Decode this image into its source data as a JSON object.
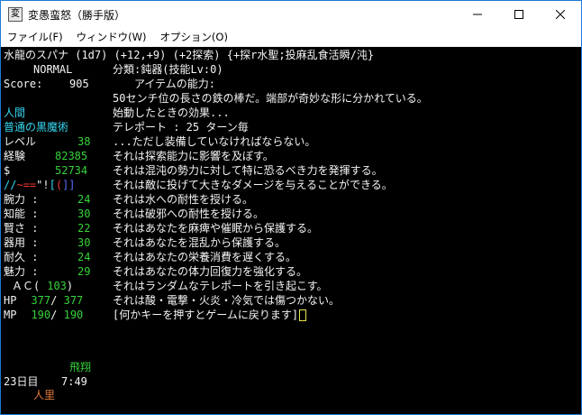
{
  "window": {
    "title": "変愚蛮怒（勝手版）",
    "icon_label": "変",
    "controls": [
      "minimize-icon",
      "maximize-icon",
      "close-icon"
    ]
  },
  "menubar": {
    "items": [
      "ファイル(F)",
      "ウィンドウ(W)",
      "オプション(O)"
    ]
  },
  "item_header": "水龍のスパナ (1d7) (+12,+9) (+2探索) {+探r水聖;投麻乱食活瞬/沌}",
  "status": {
    "mode": "NORMAL",
    "score_label": "Score:",
    "score": "905",
    "race": "人間",
    "class": "普通の黒魔術",
    "level_label": "レベル",
    "level": "38",
    "exp_label": "経験",
    "exp": "82385",
    "gold_label": "$",
    "gold": "52734",
    "equip_slash": "//",
    "equip_tilde": "~==",
    "equip_quote": "\"!",
    "equip_bracket": "[",
    "equip_paren": "(",
    "equip_close": "]]",
    "stats": [
      {
        "label": "腕力 :",
        "value": "24"
      },
      {
        "label": "知能 :",
        "value": "30"
      },
      {
        "label": "賢さ :",
        "value": "22"
      },
      {
        "label": "器用 :",
        "value": "30"
      },
      {
        "label": "耐久 :",
        "value": "24"
      },
      {
        "label": "魅力 :",
        "value": "29"
      }
    ],
    "ac_label": "ＡＣ(",
    "ac_value": "103",
    "ac_close": ")",
    "hp_label": "HP",
    "hp_cur": "377",
    "hp_max": "377",
    "mp_label": "MP",
    "mp_cur": "190",
    "mp_max": "190",
    "state": "飛翔",
    "day": "23日目",
    "time": "7:49",
    "location": "人里"
  },
  "description_lines": [
    "分類:鈍器(技能Lv:0)",
    "　　アイテムの能力:",
    "50センチ位の長さの鉄の棒だ。端部が奇妙な形に分かれている。",
    "始動したときの効果...",
    "テレポート : 25 ターン毎",
    "...ただし装備していなければならない。",
    "それは探索能力に影響を及ぼす。",
    "それは混沌の勢力に対して特に恐るべき力を発揮する。",
    "それは敵に投げて大きなダメージを与えることができる。",
    "それは水への耐性を授ける。",
    "それは破邪への耐性を授ける。",
    "それはあなたを麻痺や催眠から保護する。",
    "それはあなたを混乱から保護する。",
    "それはあなたの栄養消費を遅くする。",
    "それはあなたの体力回復力を強化する。",
    "それはランダムなテレポートを引き起こす。",
    "それは酸・電撃・火炎・冷気では傷つかない。",
    "[何かキーを押すとゲームに戻ります]"
  ],
  "colors": {
    "background": "#000000",
    "text": "#f4f4f4",
    "cyan": "#35d7f1",
    "green": "#36d23a",
    "orange": "#e37a3b",
    "cursor": "#e7e34a"
  }
}
